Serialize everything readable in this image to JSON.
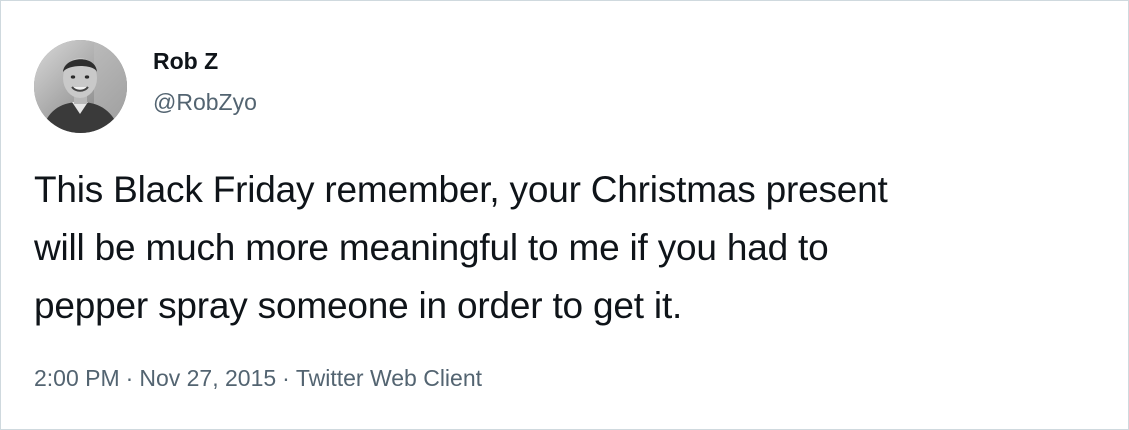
{
  "tweet": {
    "author": {
      "display_name": "Rob Z",
      "handle": "@RobZyo"
    },
    "text_lines": [
      "This Black Friday remember, your Christmas present",
      "will be much more meaningful to me if you had to",
      "pepper spray someone in order to get it."
    ],
    "meta": {
      "time": "2:00 PM",
      "separator": "·",
      "date": "Nov 27, 2015",
      "source": "Twitter Web Client"
    }
  },
  "colors": {
    "text_primary": "#0f1419",
    "text_secondary": "#536471",
    "border": "#cfd9de",
    "background": "#ffffff"
  }
}
